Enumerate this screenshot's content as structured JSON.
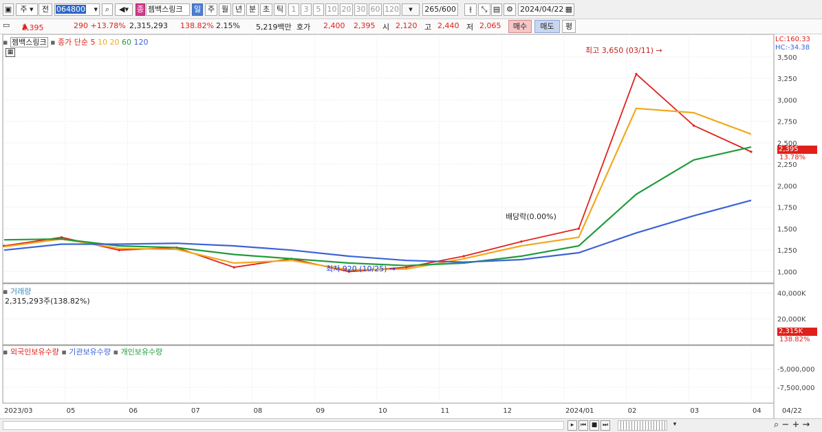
{
  "toolbar": {
    "period_label": "주",
    "prev_label": "전",
    "stock_code": "064800",
    "stock_name": "젬백스링크",
    "stock_badge": "종",
    "periods": [
      "일",
      "주",
      "월",
      "년",
      "분",
      "초",
      "틱"
    ],
    "active_period": "일",
    "intervals": [
      "1",
      "3",
      "5",
      "10",
      "20",
      "30",
      "60",
      "120"
    ],
    "count": "265",
    "count_max": "/600",
    "date": "2024/04/22"
  },
  "info": {
    "price": "2,395",
    "change": "290 +13.78%",
    "volume": "2,315,293",
    "volume_ratio": "138.82%",
    "turnover_ratio": "2.15%",
    "amount": "5,219백만",
    "ask_label": "호가",
    "ask_price": "2,400",
    "bid_price": "2,395",
    "open_label": "시",
    "open": "2,120",
    "high_label": "고",
    "high": "2,440",
    "low_label": "저",
    "low": "2,065",
    "buy_label": "매수",
    "sell_label": "매도",
    "avg_label": "평"
  },
  "price_panel": {
    "stock_label": "젬백스링크",
    "ma_label": "종가 단순",
    "ma_periods": [
      "5",
      "10",
      "20",
      "60",
      "120"
    ],
    "ma_colors": [
      "#e0201b",
      "#f2a81d",
      "#f2a81d",
      "#1f9b3a",
      "#3b63d8"
    ],
    "lc": "LC:160.33",
    "hc": "HC:-34.38",
    "y_ticks": [
      "3,500",
      "3,250",
      "3,000",
      "2,750",
      "2,500",
      "2,250",
      "2,000",
      "1,750",
      "1,500",
      "1,250",
      "1,000"
    ],
    "current_price_tag": "2,395",
    "current_pct_tag": "13.78%",
    "high_annotation": "최고 3,650 (03/11)",
    "low_annotation": "최저 920 (10/25)",
    "dividend_annotation": "배당락(0.00%)"
  },
  "volume_panel": {
    "title": "거래량",
    "value_text": "2,315,293주(138.82%)",
    "y_ticks": [
      "40,000K",
      "20,000K"
    ],
    "current_tag": "2,315K",
    "current_pct_tag": "138.82%"
  },
  "holding_panel": {
    "series": [
      {
        "name": "외국인보유수량",
        "color": "#e0201b"
      },
      {
        "name": "기관보유수량",
        "color": "#3b63d8"
      },
      {
        "name": "개인보유수량",
        "color": "#1f9b3a"
      }
    ],
    "y_ticks": [
      "-5,000,000",
      "-7,500,000"
    ]
  },
  "x_axis": {
    "labels": [
      "2023/03",
      "05",
      "06",
      "07",
      "08",
      "09",
      "10",
      "11",
      "12",
      "2024/01",
      "02",
      "03",
      "04",
      "04/22"
    ]
  },
  "chart_data": {
    "type": "line",
    "title": "젬백스링크",
    "x": [
      "2023/03",
      "05",
      "06",
      "07",
      "08",
      "09",
      "10",
      "11",
      "12",
      "2024/01",
      "02",
      "03",
      "04",
      "04/22"
    ],
    "series": [
      {
        "name": "종가 단순 5",
        "values": [
          1300,
          1400,
          1250,
          1280,
          1050,
          1150,
          1000,
          1050,
          1180,
          1350,
          1500,
          3300,
          2700,
          2395
        ]
      },
      {
        "name": "종가 단순 20",
        "values": [
          1290,
          1380,
          1270,
          1260,
          1100,
          1130,
          1020,
          1030,
          1150,
          1300,
          1400,
          2900,
          2850,
          2600
        ]
      },
      {
        "name": "종가 단순 60",
        "values": [
          1370,
          1380,
          1300,
          1280,
          1200,
          1150,
          1100,
          1070,
          1100,
          1180,
          1300,
          1900,
          2300,
          2450
        ]
      },
      {
        "name": "종가 단순 120",
        "values": [
          1250,
          1320,
          1320,
          1330,
          1300,
          1250,
          1180,
          1130,
          1110,
          1140,
          1220,
          1450,
          1650,
          1830
        ]
      }
    ],
    "ylim": [
      900,
      3650
    ],
    "grid": true
  }
}
